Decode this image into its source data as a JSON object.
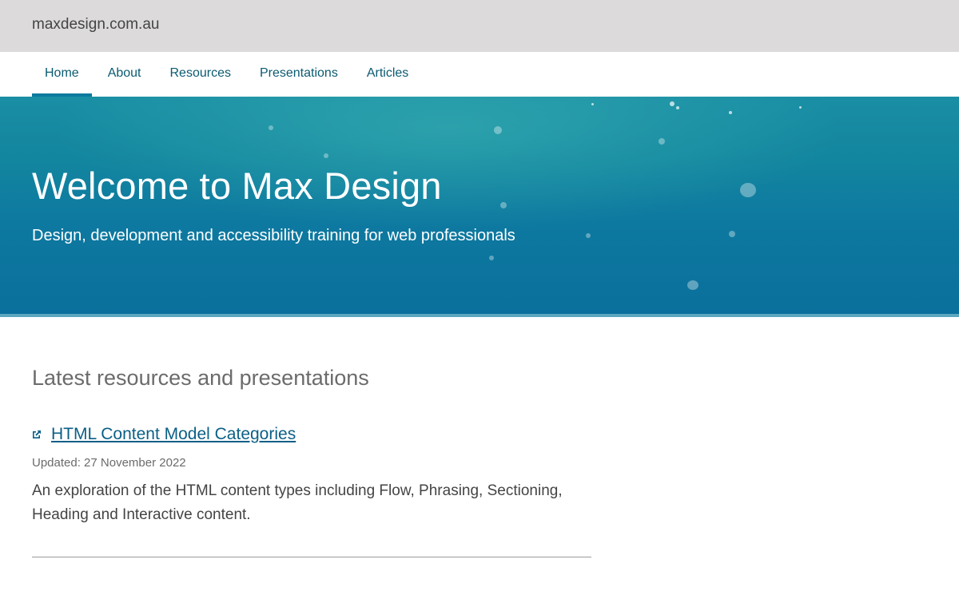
{
  "header": {
    "site_name": "maxdesign.com.au"
  },
  "nav": {
    "items": [
      {
        "label": "Home",
        "active": true
      },
      {
        "label": "About"
      },
      {
        "label": "Resources"
      },
      {
        "label": "Presentations"
      },
      {
        "label": "Articles"
      }
    ]
  },
  "hero": {
    "title": "Welcome to Max Design",
    "subtitle": "Design, development and accessibility training for web professionals"
  },
  "latest": {
    "heading": "Latest resources and presentations",
    "items": [
      {
        "title": "HTML Content Model Categories",
        "updated": "Updated: 27 November 2022",
        "description": "An exploration of the HTML content types including Flow, Phrasing, Sectioning, Heading and Interactive content."
      }
    ]
  },
  "colors": {
    "topbar_bg": "#dcdadb",
    "nav_link": "#0b5a70",
    "hero_bg": "#0e7aa0",
    "link": "#0b5f86"
  },
  "icons": {
    "external_link": "external-link-icon"
  }
}
